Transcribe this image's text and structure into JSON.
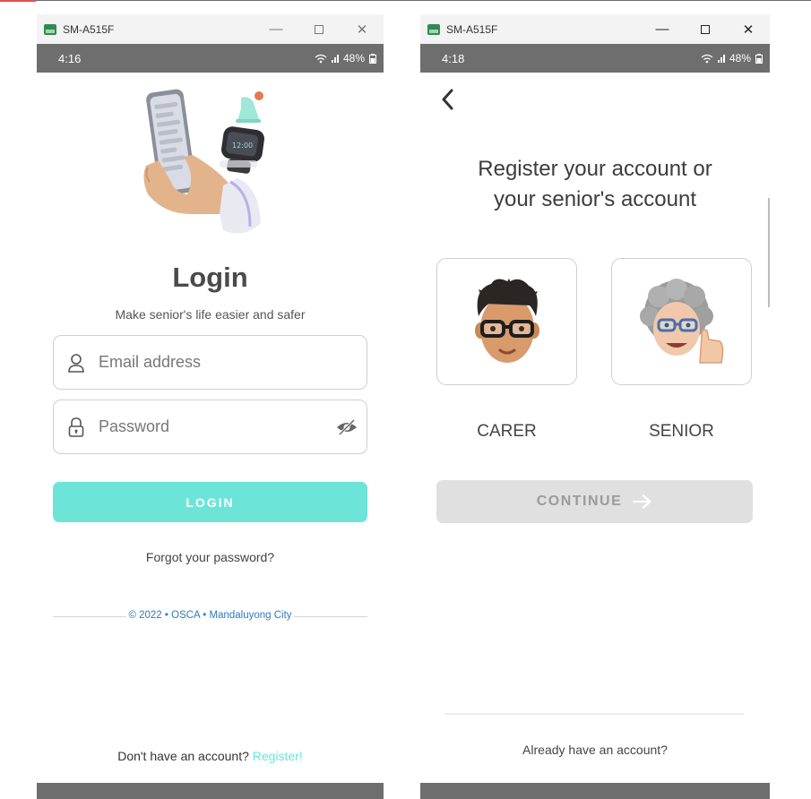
{
  "left_window": {
    "title": "SM-A515F",
    "status": {
      "time": "4:16",
      "battery": "48%"
    },
    "login": {
      "title": "Login",
      "subtitle": "Make senior's life easier and safer",
      "email_placeholder": "Email address",
      "password_placeholder": "Password",
      "login_button": "LOGIN",
      "forgot": "Forgot your password?",
      "copyright": "© 2022 • OSCA • Mandaluyong City",
      "no_account": "Don't have an account?",
      "register_link": "Register!"
    }
  },
  "right_window": {
    "title": "SM-A515F",
    "status": {
      "time": "4:18",
      "battery": "48%"
    },
    "register": {
      "title_line1": "Register your account or",
      "title_line2": "your senior's account",
      "carer_label": "CARER",
      "senior_label": "SENIOR",
      "continue_button": "CONTINUE",
      "have_account": "Already have an account?"
    }
  },
  "window_controls": {
    "minimize": "—",
    "close": "✕"
  },
  "colors": {
    "accent": "#6ce5d8",
    "link": "#2f79c1",
    "statusbar": "#6e6e6e",
    "disabled": "#e0e0e0"
  }
}
